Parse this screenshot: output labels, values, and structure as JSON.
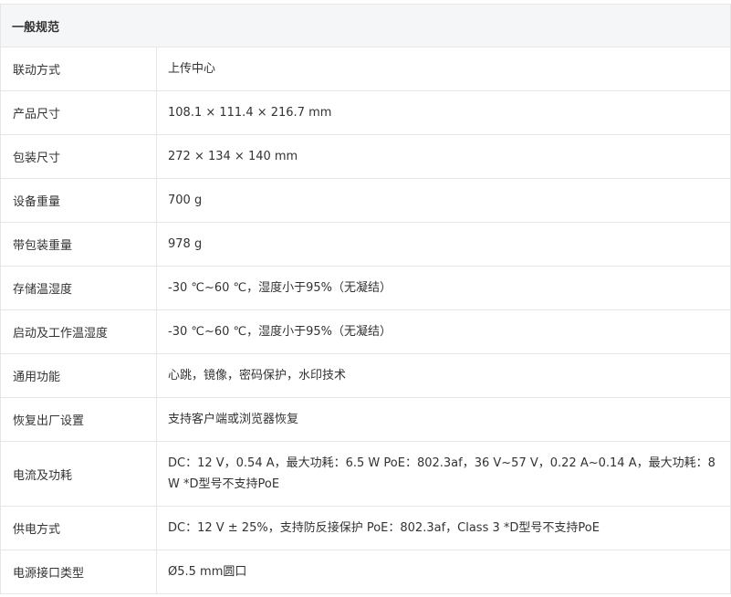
{
  "section": {
    "title": "一般规范"
  },
  "rows": [
    {
      "label": "联动方式",
      "value": "上传中心"
    },
    {
      "label": "产品尺寸",
      "value": "108.1 × 111.4 × 216.7 mm"
    },
    {
      "label": "包装尺寸",
      "value": "272 × 134 × 140 mm"
    },
    {
      "label": "设备重量",
      "value": "700 g"
    },
    {
      "label": "带包装重量",
      "value": "978 g"
    },
    {
      "label": "存储温湿度",
      "value": "-30 ℃~60 ℃，湿度小于95%（无凝结）"
    },
    {
      "label": "启动及工作温湿度",
      "value": "-30 ℃~60 ℃，湿度小于95%（无凝结）"
    },
    {
      "label": "通用功能",
      "value": "心跳，镜像，密码保护，水印技术"
    },
    {
      "label": "恢复出厂设置",
      "value": "支持客户端或浏览器恢复"
    },
    {
      "label": "电流及功耗",
      "value": "DC：12 V，0.54 A，最大功耗：6.5 W PoE：802.3af，36 V~57 V，0.22 A~0.14 A，最大功耗：8 W *D型号不支持PoE"
    },
    {
      "label": "供电方式",
      "value": "DC：12 V ± 25%，支持防反接保护 PoE：802.3af，Class 3 *D型号不支持PoE"
    },
    {
      "label": "电源接口类型",
      "value": "Ø5.5 mm圆口"
    }
  ]
}
